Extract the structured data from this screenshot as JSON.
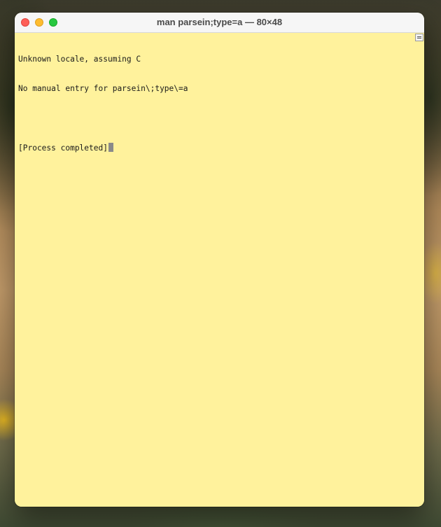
{
  "window": {
    "title": "man parsein;type=a — 80×48",
    "controls": [
      "close",
      "minimize",
      "zoom"
    ]
  },
  "terminal": {
    "background_color": "#fff29c",
    "lines": [
      "Unknown locale, assuming C",
      "No manual entry for parsein\\;type\\=a",
      "",
      "[Process completed]"
    ]
  }
}
